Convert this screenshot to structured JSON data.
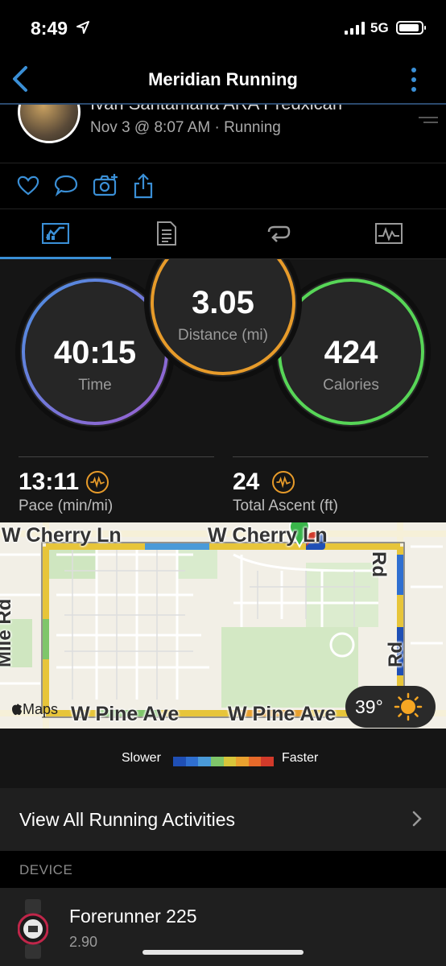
{
  "status_bar": {
    "time": "8:49",
    "network": "5G"
  },
  "nav": {
    "title": "Meridian Running"
  },
  "activity": {
    "owner_name": "Ivan Santamaria ARA Predxican",
    "meta": "Nov 3 @ 8:07 AM · Running"
  },
  "tabs": [
    {
      "icon": "chart-summary-icon",
      "active": true
    },
    {
      "icon": "document-details-icon",
      "active": false
    },
    {
      "icon": "laps-loop-icon",
      "active": false
    },
    {
      "icon": "graph-icon",
      "active": false
    }
  ],
  "rings": {
    "time": {
      "value": "40:15",
      "label": "Time",
      "color": "#7b7fe0"
    },
    "distance": {
      "value": "3.05",
      "label": "Distance (mi)",
      "color": "#e79b2a"
    },
    "calories": {
      "value": "424",
      "label": "Calories",
      "color": "#57d657"
    }
  },
  "metrics": {
    "pace": {
      "value": "13:11",
      "label": "Pace (min/mi)"
    },
    "ascent": {
      "value": "24",
      "label": "Total Ascent (ft)"
    }
  },
  "map": {
    "streets": {
      "cherry_1": "W Cherry Ln",
      "cherry_2": "W Cherry Ln",
      "pine_1": "W Pine Ave",
      "pine_2": "W Pine Ave",
      "left_rd": "Mile Rd",
      "right_rd": "Rd",
      "right_rd_top": "Rd"
    },
    "weather": "39°",
    "attribution": "Maps"
  },
  "legend": {
    "slower": "Slower",
    "faster": "Faster",
    "colors": [
      "#1f4fb5",
      "#2f6fd0",
      "#4a9ad8",
      "#7fc66a",
      "#d7c53a",
      "#e9a12f",
      "#e66a2a",
      "#d23a2a"
    ]
  },
  "view_all": "View All Running Activities",
  "device_section": "DEVICE",
  "device": {
    "name": "Forerunner 225",
    "version": "2.90"
  },
  "colors": {
    "accent": "#3a8fd6"
  }
}
